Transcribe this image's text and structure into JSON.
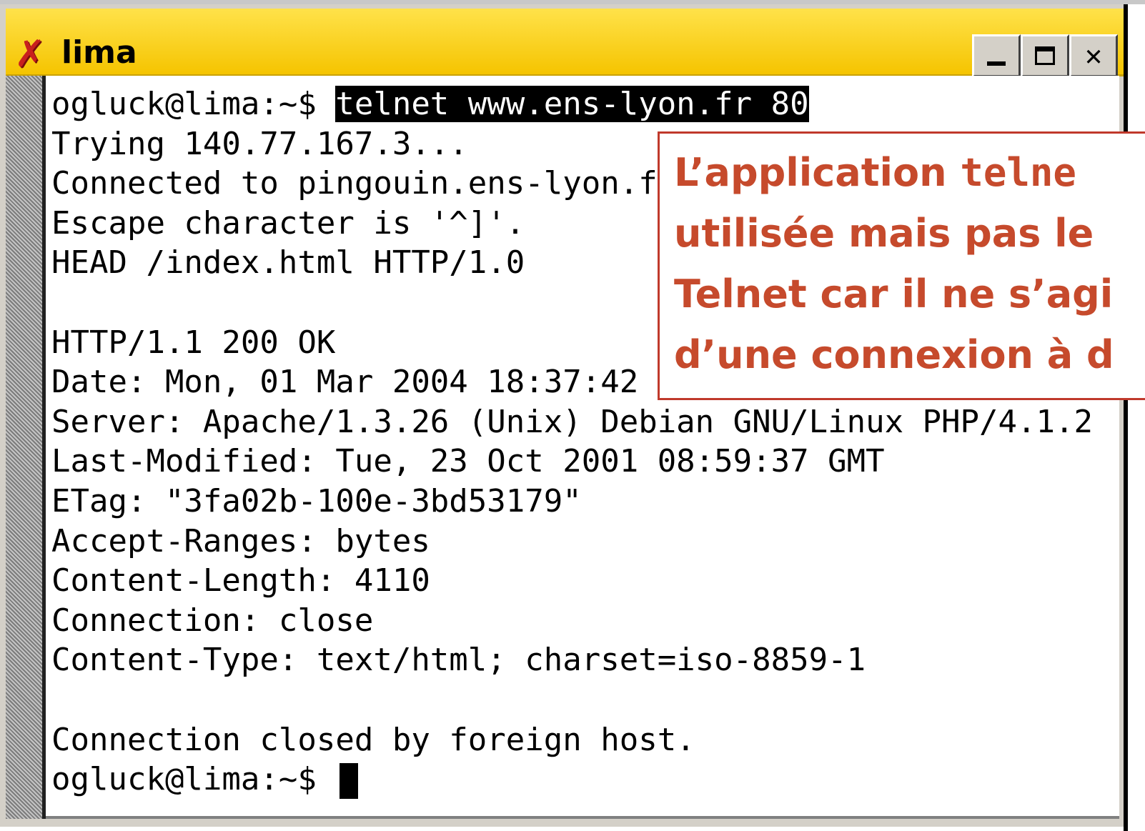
{
  "window": {
    "title": "lima",
    "buttons": {
      "minimize": "_",
      "maximize": "□",
      "close": "✕"
    }
  },
  "terminal": {
    "lines": [
      {
        "prompt": "ogluck@lima:~$ ",
        "command": "telnet www.ens-lyon.fr 80"
      },
      {
        "text": "Trying 140.77.167.3..."
      },
      {
        "text": "Connected to pingouin.ens-lyon.fr"
      },
      {
        "text": "Escape character is '^]'."
      },
      {
        "text": "HEAD /index.html HTTP/1.0"
      },
      {
        "text": ""
      },
      {
        "text": "HTTP/1.1 200 OK"
      },
      {
        "text": "Date: Mon, 01 Mar 2004 18:37:42 G"
      },
      {
        "text": "Server: Apache/1.3.26 (Unix) Debian GNU/Linux PHP/4.1.2"
      },
      {
        "text": "Last-Modified: Tue, 23 Oct 2001 08:59:37 GMT"
      },
      {
        "text": "ETag: \"3fa02b-100e-3bd53179\""
      },
      {
        "text": "Accept-Ranges: bytes"
      },
      {
        "text": "Content-Length: 4110"
      },
      {
        "text": "Connection: close"
      },
      {
        "text": "Content-Type: text/html; charset=iso-8859-1"
      },
      {
        "text": ""
      },
      {
        "text": "Connection closed by foreign host."
      },
      {
        "prompt": "ogluck@lima:~$ "
      }
    ]
  },
  "callout": {
    "line1_prefix": "L’application ",
    "line1_code": "telne",
    "line2": "utilisée mais pas le",
    "line3": "Telnet car il ne s’agi",
    "line4": "d’une connexion à d"
  },
  "colors": {
    "titlebar": "#f5c400",
    "callout_text": "#c64a2c",
    "callout_border": "#c0392b"
  }
}
